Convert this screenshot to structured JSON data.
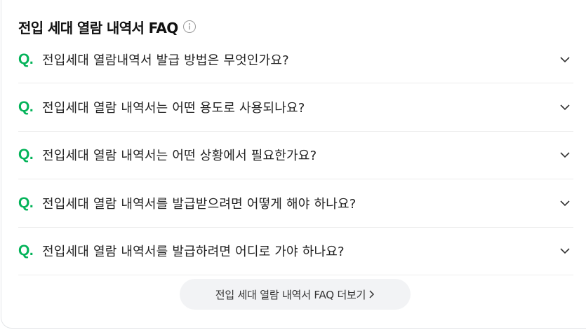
{
  "header": {
    "title": "전입 세대 열람 내역서 FAQ",
    "info_icon": "info-circle-icon"
  },
  "faq": {
    "q_prefix": "Q.",
    "items": [
      {
        "question": "전입세대 열람내역서 발급 방법은 무엇인가요?"
      },
      {
        "question": "전입세대 열람 내역서는 어떤 용도로 사용되나요?"
      },
      {
        "question": "전입세대 열람 내역서는 어떤 상황에서 필요한가요?"
      },
      {
        "question": "전입세대 열람 내역서를 발급받으려면 어떻게 해야 하나요?"
      },
      {
        "question": "전입세대 열람 내역서를 발급하려면 어디로 가야 하나요?"
      }
    ]
  },
  "more": {
    "label": "전입 세대 열람 내역서 FAQ 더보기"
  },
  "colors": {
    "accent": "#03b359",
    "text": "#222222",
    "divider": "#ececec",
    "button_bg": "#f2f3f5"
  }
}
